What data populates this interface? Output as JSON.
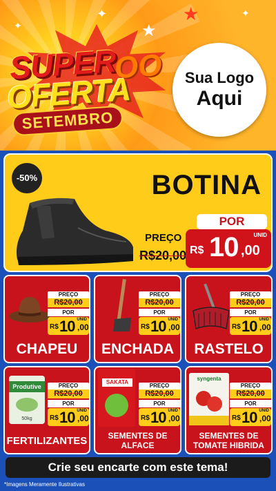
{
  "hero": {
    "title_line1": "SUPER",
    "title_line2": "OFERTA",
    "title_suffix": "OO",
    "month": "SETEMBRO",
    "logo_line1": "Sua Logo",
    "logo_line2": "Aqui"
  },
  "featured": {
    "discount": "-50%",
    "name": "BOTINA",
    "price_label": "PREÇO",
    "old_price": "R$20,00",
    "por_label": "POR",
    "currency": "R$",
    "price_int": "10",
    "price_dec": ",00",
    "unit": "UNID"
  },
  "products": [
    {
      "name": "CHAPEU",
      "price_label": "PREÇO",
      "old_price": "R$20,00",
      "por_label": "POR",
      "currency": "R$",
      "price_int": "10",
      "price_dec": ",00",
      "unit": "UNID"
    },
    {
      "name": "ENCHADA",
      "price_label": "PREÇO",
      "old_price": "R$20,00",
      "por_label": "POR",
      "currency": "R$",
      "price_int": "10",
      "price_dec": ",00",
      "unit": "UNID"
    },
    {
      "name": "RASTELO",
      "price_label": "PREÇO",
      "old_price": "R$20,00",
      "por_label": "POR",
      "currency": "R$",
      "price_int": "10",
      "price_dec": ",00",
      "unit": "UNID"
    },
    {
      "name": "FERTILIZANTES",
      "price_label": "PREÇO",
      "old_price": "R$20,00",
      "por_label": "POR",
      "currency": "R$",
      "price_int": "10",
      "price_dec": ",00",
      "unit": "UNID",
      "pack_brand": "Produtive",
      "pack_weight": "50kg"
    },
    {
      "name_line1": "SEMENTES DE",
      "name_line2": "ALFACE",
      "price_label": "PREÇO",
      "old_price": "R$20,00",
      "por_label": "POR",
      "currency": "R$",
      "price_int": "10",
      "price_dec": ",00",
      "unit": "UNID",
      "pack_brand": "SAKATA"
    },
    {
      "name_line1": "SEMENTES DE",
      "name_line2": "TOMATE HIBRIDA",
      "price_label": "PREÇO",
      "old_price": "R$20,00",
      "por_label": "POR",
      "currency": "R$",
      "price_int": "10",
      "price_dec": ",00",
      "unit": "UNID",
      "pack_brand": "syngenta"
    }
  ],
  "cta": "Crie seu encarte com este tema!",
  "disclaimer": "*Imagens Meramente Ilustrativas",
  "colors": {
    "red": "#c8131c",
    "yellow": "#ffcc1a",
    "blue": "#1c50b9",
    "dark": "#1b1b1b"
  }
}
